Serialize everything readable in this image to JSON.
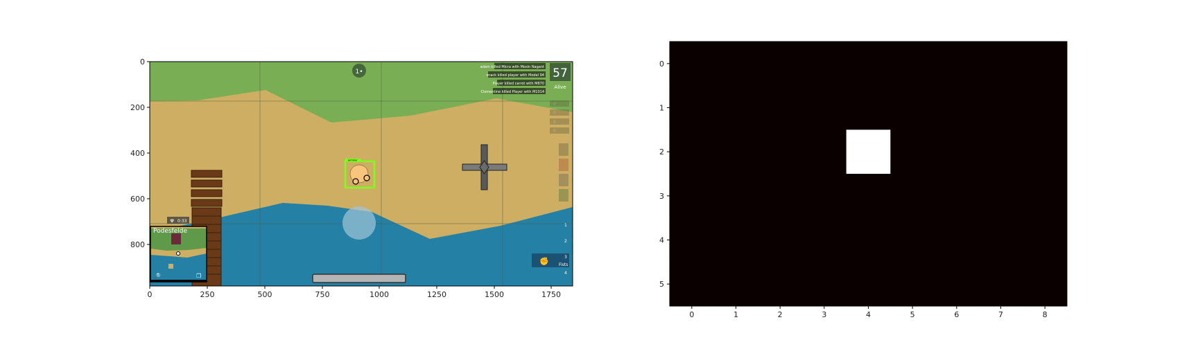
{
  "game": {
    "xticks": [
      "0",
      "250",
      "500",
      "750",
      "1000",
      "1250",
      "1500",
      "1750"
    ],
    "yticks": [
      "0",
      "200",
      "400",
      "600",
      "800"
    ],
    "alive_count": "57",
    "alive_label": "Alive",
    "kill_feed": [
      "adam killed Micra with Mosin Nagant",
      "snack killed player with Model 94",
      "Player killed carrot with M870",
      "Clementine killed Player with M1014"
    ],
    "minimap_label": "Podesfelde",
    "gas_timer": "0:33",
    "player_label": "Jammer",
    "weapon_slots": [
      "1",
      "2",
      "3",
      "4"
    ],
    "active_slot_label": "Fists",
    "top_indicator": "1•",
    "ammo_counts": [
      "0",
      "0",
      "0",
      "0"
    ],
    "colors": {
      "grass": "#7aae54",
      "sand": "#cdae63",
      "water": "#2580a6",
      "dock": "#6a3918",
      "player": "#f9c47c",
      "target_box": "#7dff1f"
    }
  },
  "heatmap": {
    "xticks": [
      "0",
      "1",
      "2",
      "3",
      "4",
      "5",
      "6",
      "7",
      "8"
    ],
    "yticks": [
      "0",
      "1",
      "2",
      "3",
      "4",
      "5"
    ]
  },
  "chart_data": [
    {
      "type": "heatmap",
      "rows": 6,
      "cols": 9,
      "xlim": [
        -0.5,
        8.5
      ],
      "ylim": [
        5.5,
        -0.5
      ],
      "values": [
        [
          0,
          0,
          0,
          0,
          0,
          0,
          0,
          0,
          0
        ],
        [
          0,
          0,
          0,
          0,
          0,
          0,
          0,
          0,
          0
        ],
        [
          0,
          0,
          0,
          0,
          1,
          0,
          0,
          0,
          0
        ],
        [
          0,
          0,
          0,
          0,
          0,
          0,
          0,
          0,
          0
        ],
        [
          0,
          0,
          0,
          0,
          0,
          0,
          0,
          0,
          0
        ],
        [
          0,
          0,
          0,
          0,
          0,
          0,
          0,
          0,
          0
        ]
      ],
      "colormap": "hot"
    }
  ]
}
